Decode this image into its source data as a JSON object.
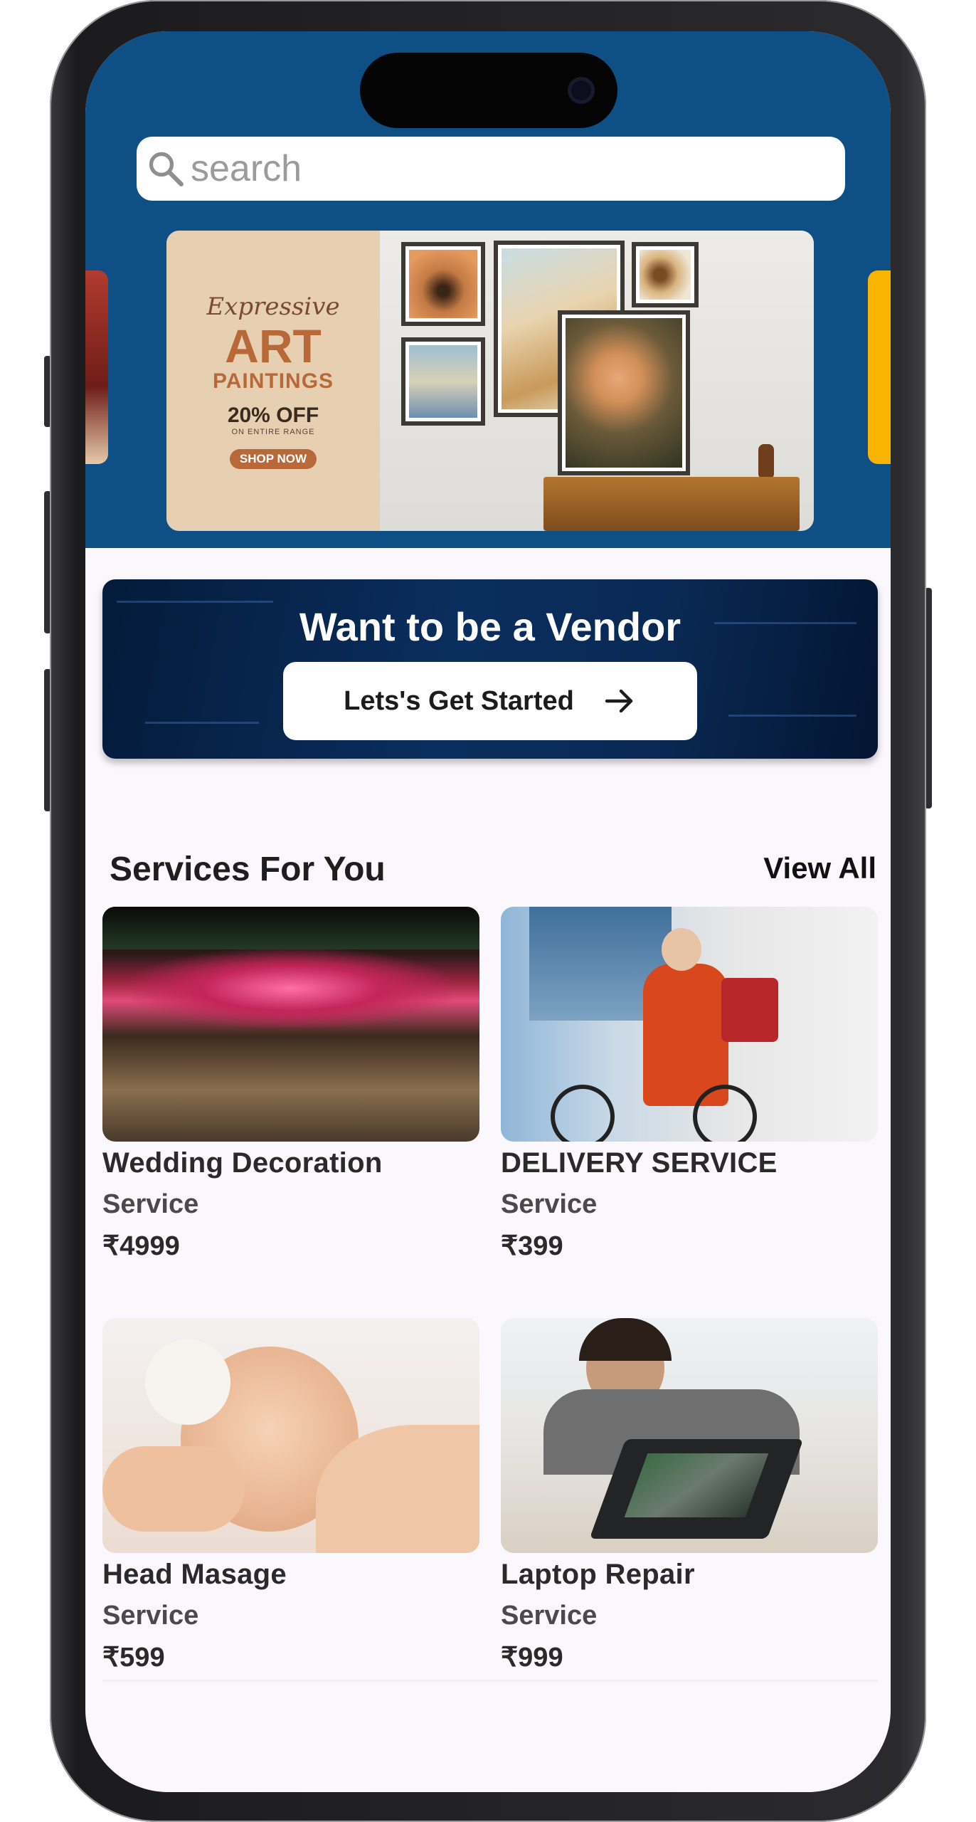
{
  "search": {
    "placeholder": "search"
  },
  "banner": {
    "tagline": "Expressive",
    "headline": "ART",
    "subheadline": "PAINTINGS",
    "offer": "20% OFF",
    "offer_note": "ON ENTIRE RANGE",
    "cta": "SHOP NOW"
  },
  "vendor": {
    "title": "Want to be a Vendor",
    "button_label": "Lets's Get Started"
  },
  "services": {
    "title": "Services For You",
    "view_all": "View All",
    "items": [
      {
        "name": "Wedding Decoration",
        "type": "Service",
        "price": "₹4999"
      },
      {
        "name": "DELIVERY SERVICE",
        "type": "Service",
        "price": "₹399"
      },
      {
        "name": "Head Masage",
        "type": "Service",
        "price": "₹599"
      },
      {
        "name": "Laptop Repair",
        "type": "Service",
        "price": "₹999"
      }
    ]
  },
  "colors": {
    "header_bg": "#0e4f86",
    "vendor_bg": "#0a2e5e",
    "accent_art": "#b8693a",
    "carousel_peek_right": "#f8b400"
  }
}
